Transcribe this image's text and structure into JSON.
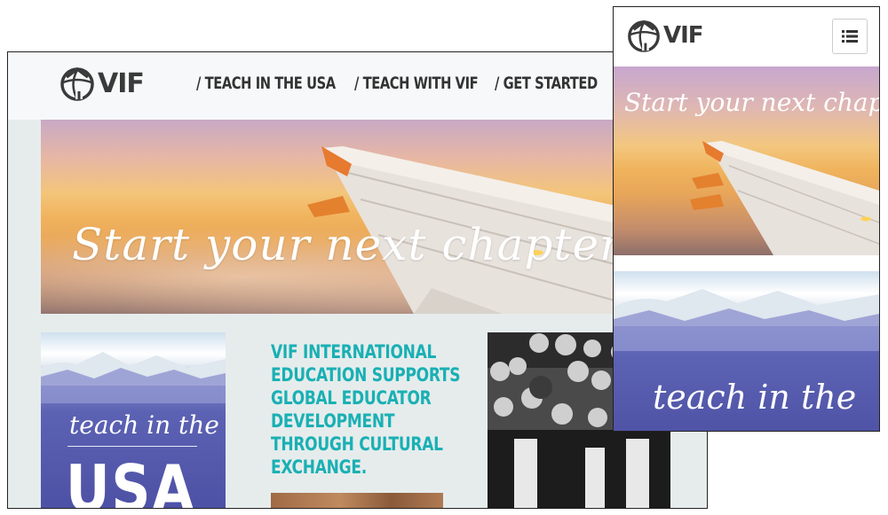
{
  "brand": {
    "logo_text": "VIF"
  },
  "nav": {
    "items": [
      {
        "label": "/ TEACH IN THE USA"
      },
      {
        "label": "/ TEACH WITH VIF"
      },
      {
        "label": "/ GET STARTED"
      }
    ]
  },
  "hero": {
    "headline": "Start your next chapter."
  },
  "cards": {
    "usa_script": "teach in the",
    "usa_big": "USA"
  },
  "mission": {
    "lines": [
      "VIF INTERNATIONAL",
      "EDUCATION SUPPORTS",
      "GLOBAL EDUCATOR",
      "DEVELOPMENT",
      "THROUGH CULTURAL",
      "EXCHANGE."
    ]
  },
  "mobile": {
    "logo_text": "VIF",
    "hero_headline": "Start your next chapter",
    "card_text": "teach in the",
    "menu_icon": "list-menu-icon"
  },
  "colors": {
    "accent_teal": "#19b0b4",
    "usa_purple": "#5059a9",
    "sunset_orange": "#f0b35c"
  }
}
